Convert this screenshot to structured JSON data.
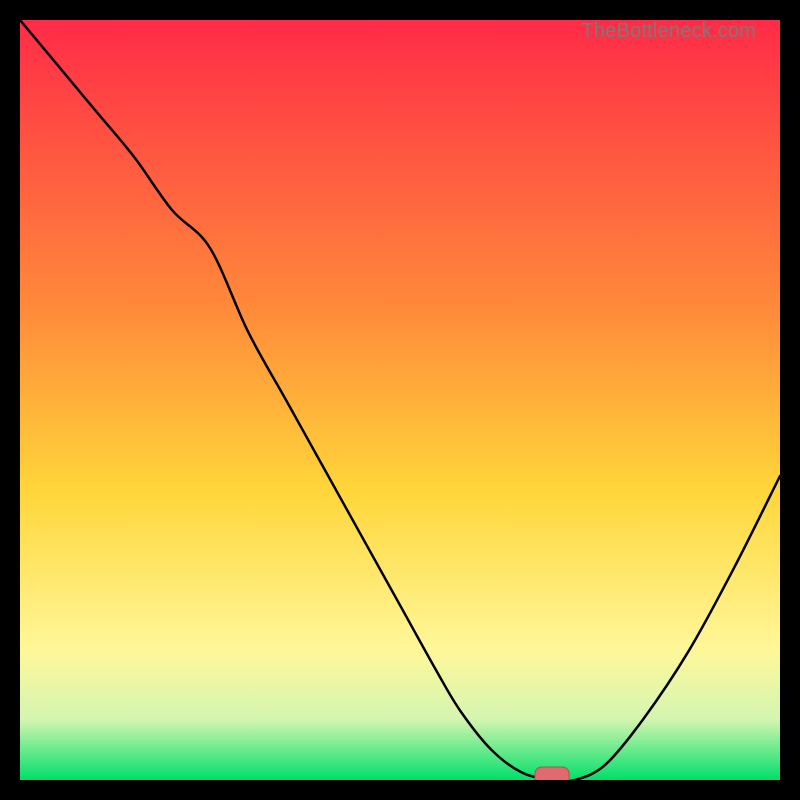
{
  "watermark": "TheBottleneck.com",
  "colors": {
    "frame": "#000000",
    "gradient_top": "#ff2b47",
    "gradient_mid1": "#ff8a3a",
    "gradient_mid2": "#ffd63a",
    "gradient_low": "#fff79a",
    "gradient_green_pale": "#d4f5b0",
    "gradient_green": "#00e06a",
    "curve": "#000000",
    "marker_fill": "#e06a6e",
    "marker_stroke": "#b94d52",
    "watermark": "#7a7a7a"
  },
  "chart_data": {
    "type": "line",
    "title": "",
    "xlabel": "",
    "ylabel": "",
    "xlim": [
      0,
      100
    ],
    "ylim": [
      0,
      100
    ],
    "grid": false,
    "legend": false,
    "x": [
      0,
      5,
      10,
      15,
      20,
      25,
      30,
      35,
      40,
      45,
      50,
      55,
      58,
      62,
      66,
      70,
      73,
      77,
      82,
      88,
      94,
      100
    ],
    "y": [
      100,
      94,
      88,
      82,
      75,
      70,
      59,
      50,
      41,
      32,
      23,
      14,
      9,
      4,
      1,
      0,
      0,
      2,
      8,
      17,
      28,
      40
    ],
    "marker": {
      "x": 70,
      "y": 0,
      "w": 4.5,
      "h": 2.2
    },
    "annotations": [
      {
        "text": "TheBottleneck.com",
        "pos": "top-right"
      }
    ]
  }
}
